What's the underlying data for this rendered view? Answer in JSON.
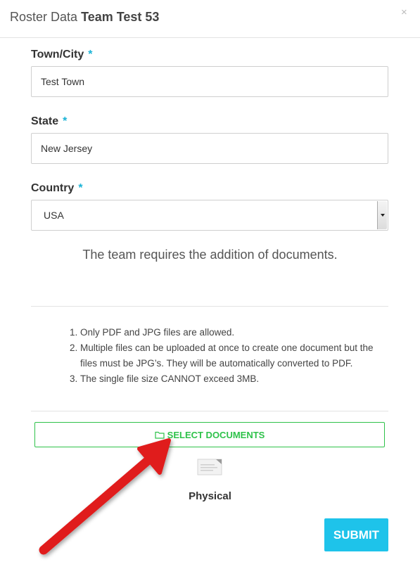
{
  "header": {
    "title_prefix": "Roster Data",
    "title_team": "Team Test 53",
    "close_label": "×"
  },
  "form": {
    "town": {
      "label": "Town/City",
      "required": "*",
      "value": "Test Town"
    },
    "state": {
      "label": "State",
      "required": "*",
      "value": "New Jersey"
    },
    "country": {
      "label": "Country",
      "required": "*",
      "value": "USA"
    }
  },
  "notice": "The team requires the addition of documents.",
  "rules": [
    "Only PDF and JPG files are allowed.",
    "Multiple files can be uploaded at once to create one document but the files must be JPG’s. They will be automatically converted to PDF.",
    "The single file size CANNOT exceed 3MB."
  ],
  "select_documents_label": "SELECT DOCUMENTS",
  "document_type": "Physical",
  "submit_label": "SUBMIT",
  "colors": {
    "accent": "#1ec3ea",
    "required": "#1ab3d6",
    "select_button": "#2ec24a",
    "arrow": "#e01e1e"
  },
  "icons": [
    "close-icon",
    "folder-icon",
    "document-icon",
    "dropdown-arrow-icon"
  ]
}
